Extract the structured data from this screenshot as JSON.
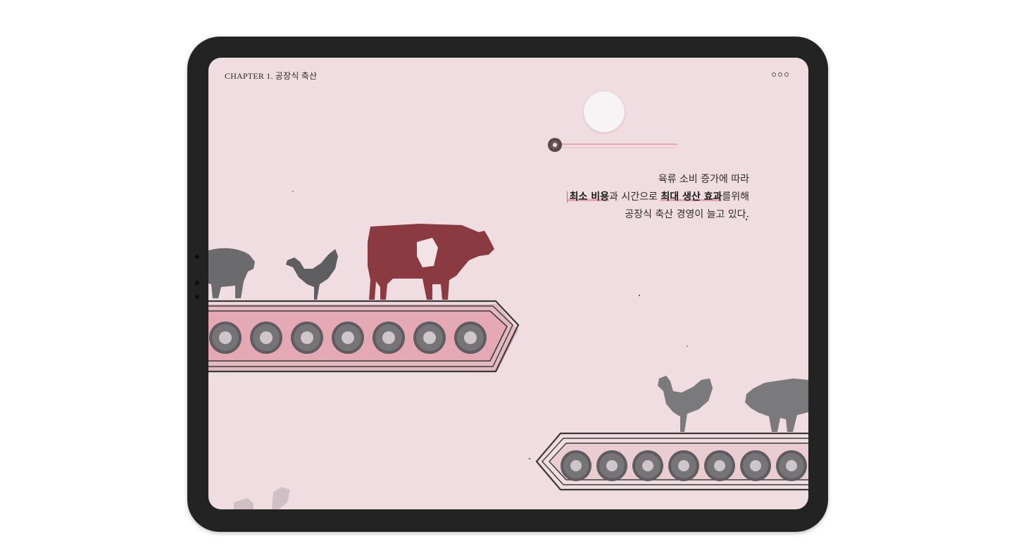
{
  "header": {
    "chapter": "CHAPTER 1. 공장식 축산",
    "menu_icon": "more-dots-icon"
  },
  "body_text": {
    "line1": "육류 소비 증가에 따라",
    "line2": {
      "highlight1": "최소 비용",
      "part1": "과 시간으로 ",
      "highlight2": "최대 생산 효과",
      "part2": "를위해"
    },
    "line3": "공장식 축산 경영이 늘고 있다."
  },
  "illustration": {
    "upper_conveyor_animals": [
      "pig",
      "rooster",
      "cow"
    ],
    "lower_conveyor_animals": [
      "rooster",
      "pig"
    ],
    "colors": {
      "background": "#efdde2",
      "cow": "#8c3a42",
      "grey_animals": "#6b6a6c",
      "conveyor_fill": "#e4a9b4",
      "device_frame": "#232324"
    }
  }
}
